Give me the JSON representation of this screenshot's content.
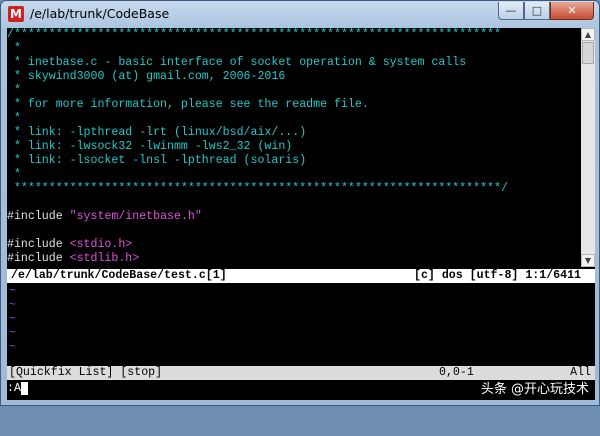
{
  "window": {
    "title": "/e/lab/trunk/CodeBase",
    "icon": "M"
  },
  "editor": {
    "lines": [
      {
        "text": "/**********************************************************************",
        "cls": "comment"
      },
      {
        "text": " *",
        "cls": "comment"
      },
      {
        "text": " * inetbase.c - basic interface of socket operation & system calls",
        "cls": "comment"
      },
      {
        "text": " * skywind3000 (at) gmail.com, 2006-2016",
        "cls": "comment"
      },
      {
        "text": " *",
        "cls": "comment"
      },
      {
        "text": " * for more information, please see the readme file.",
        "cls": "comment"
      },
      {
        "text": " *",
        "cls": "comment"
      },
      {
        "text": " * link: -lpthread -lrt (linux/bsd/aix/...)",
        "cls": "comment"
      },
      {
        "text": " * link: -lwsock32 -lwinmm -lws2_32 (win)",
        "cls": "comment"
      },
      {
        "text": " * link: -lsocket -lnsl -lpthread (solaris)",
        "cls": "comment"
      },
      {
        "text": " *",
        "cls": "comment"
      },
      {
        "text": " **********************************************************************/",
        "cls": "comment"
      },
      {
        "text": "",
        "cls": ""
      },
      {
        "directive": "#include",
        "arg": "\"system/inetbase.h\""
      },
      {
        "text": "",
        "cls": ""
      },
      {
        "directive": "#include",
        "arg": "<stdio.h>"
      },
      {
        "directive": "#include",
        "arg": "<stdlib.h>"
      }
    ]
  },
  "status_main": {
    "file": "/e/lab/trunk/CodeBase/test.c[1]",
    "info": "[c] dos [utf-8] 1:1/6411"
  },
  "quickfix": {
    "tilde_lines": [
      "~",
      "~",
      "~",
      "~",
      "~"
    ]
  },
  "status_qf": {
    "label": "[Quickfix List] [stop]",
    "position": "0,0-1",
    "scroll": "All"
  },
  "cmdline": {
    "text": ":A"
  },
  "watermark": "头条 @开心玩技术"
}
